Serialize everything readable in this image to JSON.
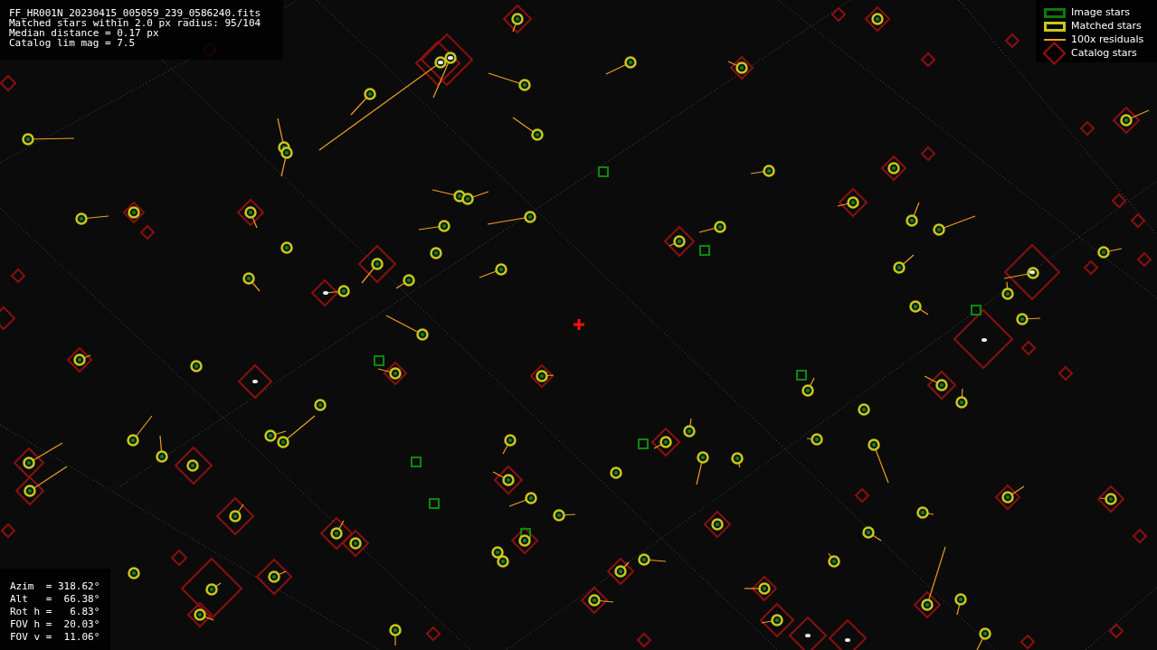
{
  "info": [
    "FF_HR001N_20230415_005059_239_0586240.fits",
    "Matched stars within 2.0 px radius: 95/104",
    "Median distance = 0.17 px",
    "Catalog lim mag = 7.5"
  ],
  "legend": [
    {
      "kind": "image",
      "label": "Image stars"
    },
    {
      "kind": "matched",
      "label": "Matched stars"
    },
    {
      "kind": "residual",
      "label": "100x residuals"
    },
    {
      "kind": "catalog",
      "label": "Catalog stars"
    }
  ],
  "pointing": [
    "Azim  = 318.62°",
    "Alt   =  66.38°",
    "Rot h =   6.83°",
    "FOV h =  20.03°",
    "FOV v =  11.06°"
  ]
}
